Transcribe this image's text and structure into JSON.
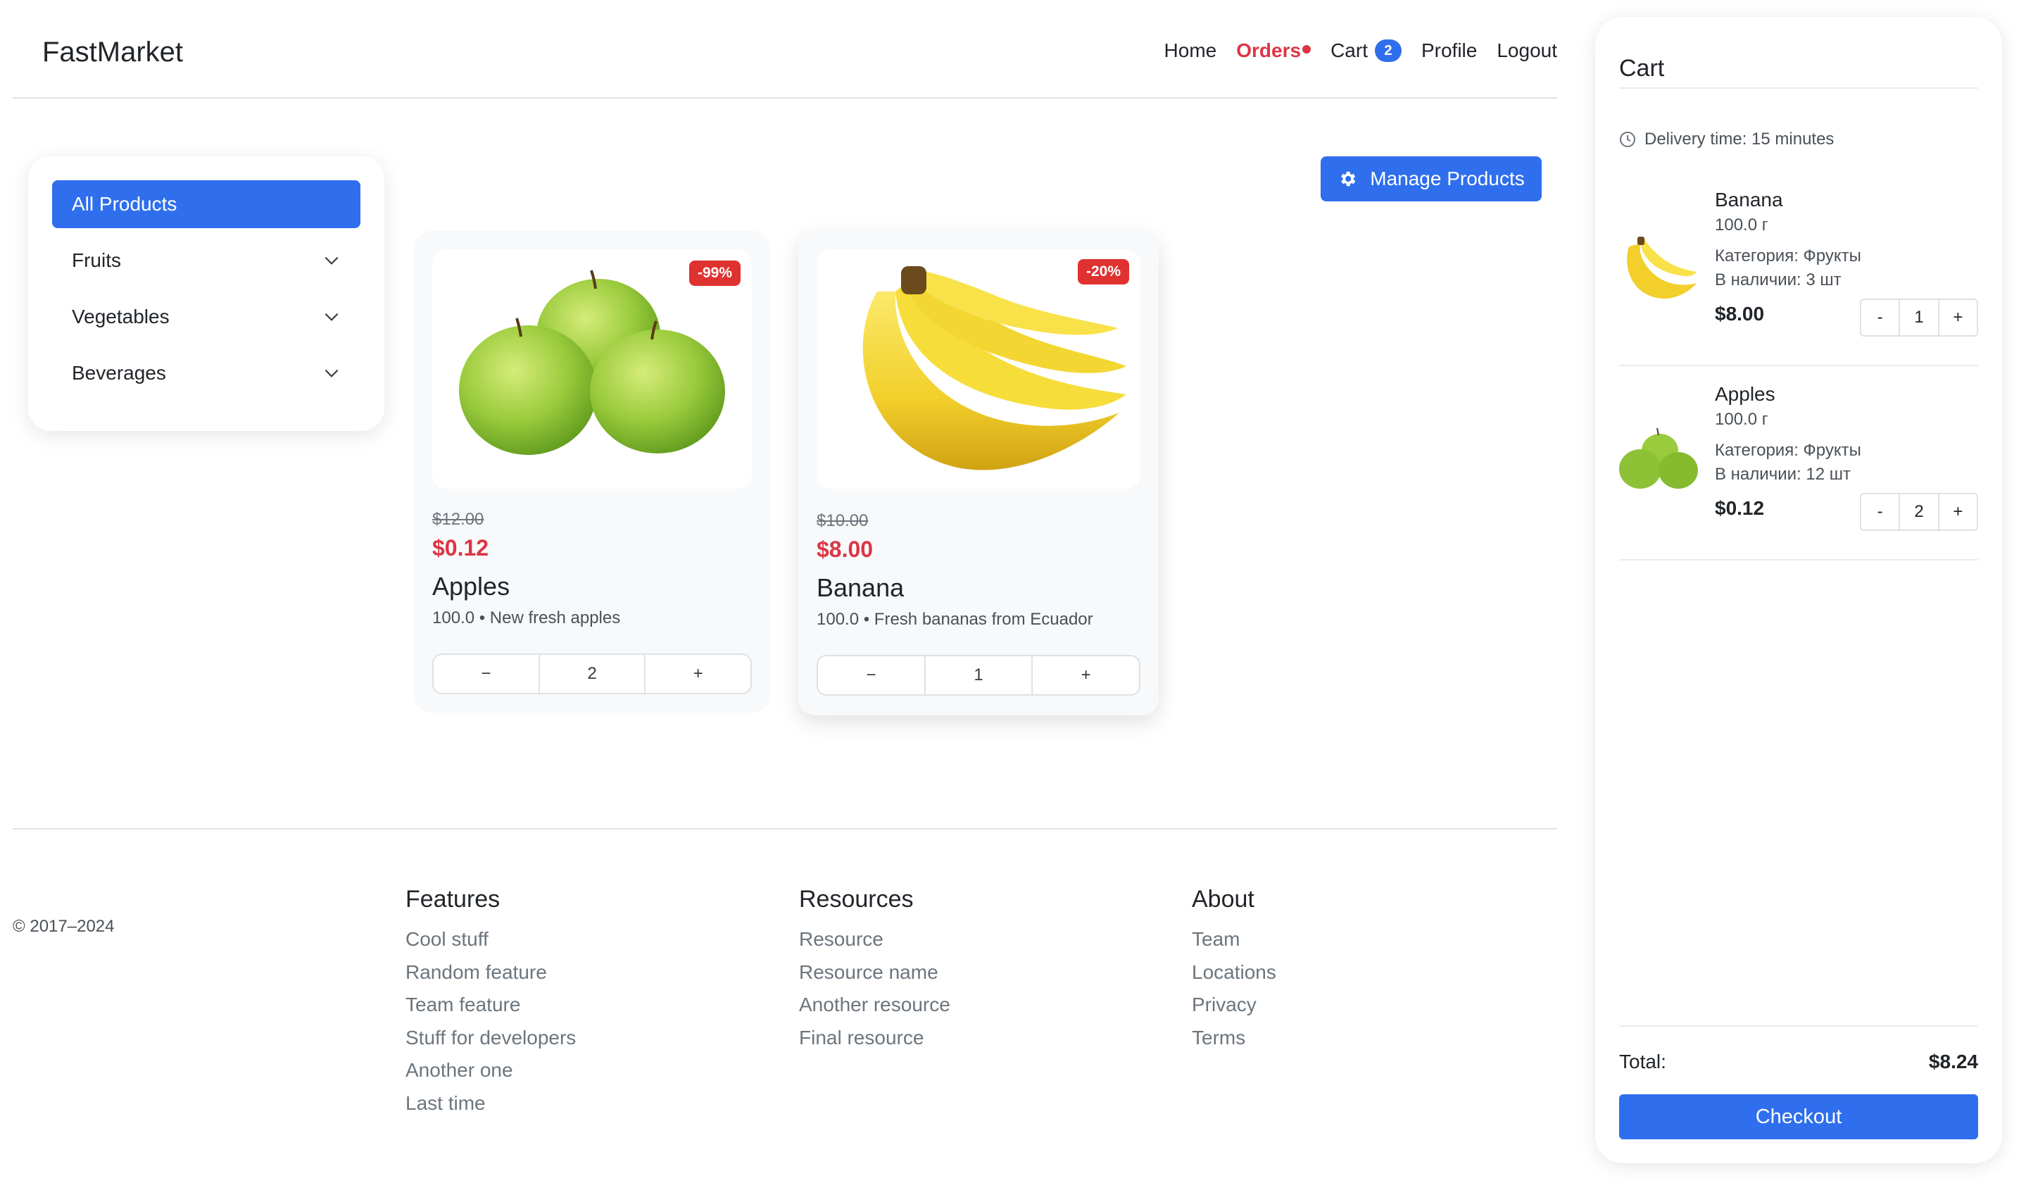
{
  "header": {
    "brand": "FastMarket",
    "nav": {
      "home": "Home",
      "orders": "Orders",
      "cart": "Cart",
      "cart_count": "2",
      "profile": "Profile",
      "logout": "Logout"
    }
  },
  "sidebar": {
    "categories": [
      {
        "label": "All Products",
        "active": true
      },
      {
        "label": "Fruits"
      },
      {
        "label": "Vegetables"
      },
      {
        "label": "Beverages"
      }
    ]
  },
  "toolbar": {
    "manage_label": "Manage Products",
    "manage_icon": "gear-icon"
  },
  "products": [
    {
      "name": "Apples",
      "discount": "-99%",
      "old_price": "$12.00",
      "new_price": "$0.12",
      "description": "100.0 • New fresh apples",
      "qty_minus": "−",
      "qty_value": "2",
      "qty_plus": "+"
    },
    {
      "name": "Banana",
      "discount": "-20%",
      "old_price": "$10.00",
      "new_price": "$8.00",
      "description": "100.0 • Fresh bananas from Ecuador",
      "qty_minus": "−",
      "qty_value": "1",
      "qty_plus": "+"
    }
  ],
  "footer": {
    "copyright": "© 2017–2024",
    "columns": [
      {
        "title": "Features",
        "links": [
          "Cool stuff",
          "Random feature",
          "Team feature",
          "Stuff for developers",
          "Another one",
          "Last time"
        ]
      },
      {
        "title": "Resources",
        "links": [
          "Resource",
          "Resource name",
          "Another resource",
          "Final resource"
        ]
      },
      {
        "title": "About",
        "links": [
          "Team",
          "Locations",
          "Privacy",
          "Terms"
        ]
      }
    ]
  },
  "cart": {
    "title": "Cart",
    "delivery": "Delivery time: 15 minutes",
    "items": [
      {
        "name": "Banana",
        "weight": "100.0 г",
        "category": "Категория: Фрукты",
        "stock": "В наличии: 3 шт",
        "price": "$8.00",
        "minus": "-",
        "qty": "1",
        "plus": "+"
      },
      {
        "name": "Apples",
        "weight": "100.0 г",
        "category": "Категория: Фрукты",
        "stock": "В наличии: 12 шт",
        "price": "$0.12",
        "minus": "-",
        "qty": "2",
        "plus": "+"
      }
    ],
    "total_label": "Total:",
    "total_value": "$8.24",
    "checkout_label": "Checkout"
  },
  "colors": {
    "accent": "#2f6fed",
    "danger": "#dc3545",
    "badge_red": "#e03131"
  }
}
